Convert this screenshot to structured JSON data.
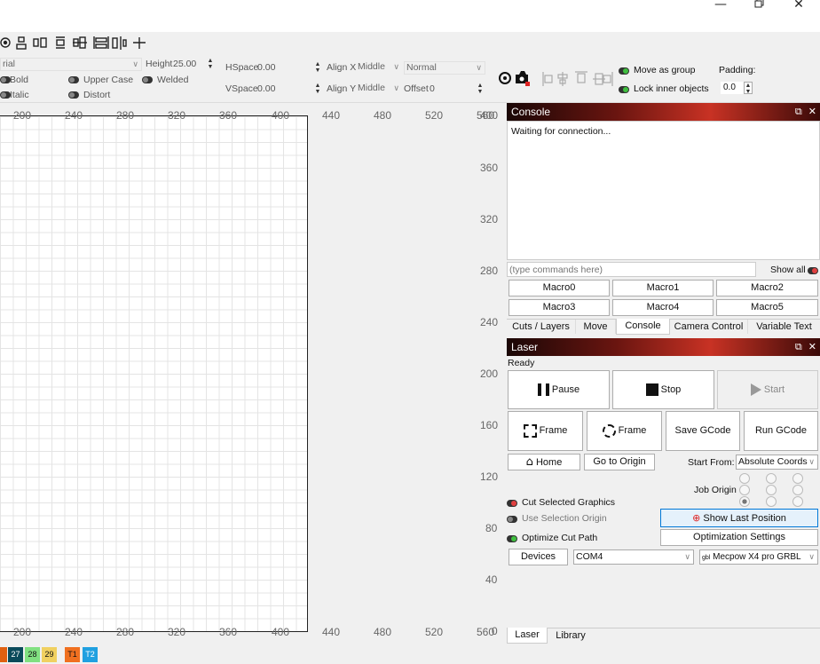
{
  "window": {
    "minimize_icon": "—",
    "restore_icon": "restore-icon",
    "close_icon": "✕"
  },
  "toolbar_icons": [
    "align-icon",
    "group-icon",
    "flip-icon",
    "distribute-icon",
    "center-icon",
    "space-icon",
    "mirror-icon",
    "size-icon"
  ],
  "text_options": {
    "font_value": "rial",
    "height_label": "Height",
    "height_value": "25.00",
    "hspace_label": "HSpace",
    "hspace_value": "0.00",
    "vspace_label": "VSpace",
    "vspace_value": "0.00",
    "align_x_label": "Align X",
    "align_x_value": "Middle",
    "align_y_label": "Align Y",
    "align_y_value": "Middle",
    "style_value": "Normal",
    "offset_label": "Offset",
    "offset_value": "0",
    "bold": "Bold",
    "italic": "Italic",
    "upper_case": "Upper Case",
    "distort": "Distort",
    "welded": "Welded",
    "move_as_group": "Move as group",
    "lock_inner": "Lock inner objects",
    "padding_label": "Padding:",
    "padding_value": "0.0"
  },
  "canvas": {
    "x_ticks": [
      "200",
      "240",
      "280",
      "320",
      "360",
      "400",
      "440",
      "480",
      "520",
      "560"
    ],
    "y_ticks": [
      "400",
      "360",
      "320",
      "280",
      "240",
      "200",
      "160",
      "120",
      "80",
      "40",
      "0"
    ]
  },
  "palette": [
    "27",
    "28",
    "29",
    "T1",
    "T2"
  ],
  "palette_colors": [
    "#e06010",
    "#0a4a5a",
    "#80e080",
    "#f0d060",
    "#f07020",
    "#20a0e0"
  ],
  "console": {
    "title": "Console",
    "status": "Waiting for connection...",
    "input_placeholder": "(type commands here)",
    "show_all": "Show all",
    "macros": [
      "Macro0",
      "Macro1",
      "Macro2",
      "Macro3",
      "Macro4",
      "Macro5"
    ]
  },
  "tabs_top": [
    "Cuts / Layers",
    "Move",
    "Console",
    "Camera Control",
    "Variable Text"
  ],
  "laser": {
    "title": "Laser",
    "status": "Ready",
    "pause": "Pause",
    "stop": "Stop",
    "start": "Start",
    "frame1": "Frame",
    "frame2": "Frame",
    "save_gcode": "Save GCode",
    "run_gcode": "Run GCode",
    "home": "Home",
    "go_to_origin": "Go to Origin",
    "start_from_label": "Start From:",
    "start_from_value": "Absolute Coords",
    "job_origin_label": "Job Origin",
    "cut_selected": "Cut Selected Graphics",
    "use_selection_origin": "Use Selection Origin",
    "optimize_cut_path": "Optimize Cut Path",
    "show_last_position": "Show Last Position",
    "optimization_settings": "Optimization Settings",
    "devices": "Devices",
    "port_value": "COM4",
    "device_value": "Mecpow X4 pro GRBL"
  },
  "tabs_bottom": [
    "Laser",
    "Library"
  ]
}
